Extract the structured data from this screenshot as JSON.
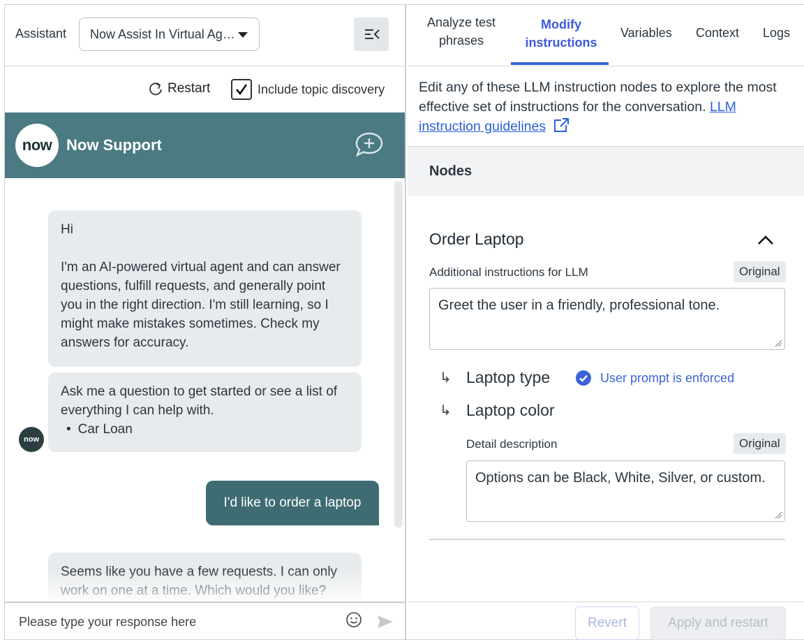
{
  "left": {
    "assistant_label": "Assistant",
    "assistant_select": "Now Assist In Virtual Ag…",
    "restart_label": "Restart",
    "include_topic_discovery": "Include topic discovery",
    "chat_title": "Now Support",
    "logo_text": "now",
    "messages": {
      "greeting": "Hi",
      "intro": "I'm an AI-powered virtual agent and can answer questions, fulfill requests, and generally point you in the right direction. I'm still learning, so I might make mistakes sometimes. Check my answers for accuracy.",
      "ask": "Ask me a question to get started or see a list of everything I can help with.",
      "bullet": "Car Loan",
      "user": "I'd like to order a laptop",
      "reply": "Seems like you have a few requests. I can only work on one at a time. Which would you like?"
    },
    "input_placeholder": "Please type your response here"
  },
  "right": {
    "tabs": {
      "analyze": "Analyze test phrases",
      "modify": "Modify instructions",
      "variables": "Variables",
      "context": "Context",
      "logs": "Logs"
    },
    "description": "Edit any of these LLM instruction nodes to explore the most effective set of instructions for the conversation.",
    "guidelines_link": "LLM instruction guidelines",
    "nodes_title": "Nodes",
    "node": {
      "title": "Order Laptop",
      "additional_label": "Additional instructions for LLM",
      "badge": "Original",
      "additional_value": "Greet the user in a friendly, professional tone.",
      "sub1": "Laptop type",
      "enforced": "User prompt is enforced",
      "sub2": "Laptop color",
      "detail_label": "Detail description",
      "detail_badge": "Original",
      "detail_value": "Options can be Black, White, Silver, or custom."
    },
    "buttons": {
      "revert": "Revert",
      "apply": "Apply and restart"
    }
  },
  "colors": {
    "header_teal": "#4b7a82",
    "user_bubble": "#3f6b72",
    "accent_blue": "#3b63d6"
  }
}
